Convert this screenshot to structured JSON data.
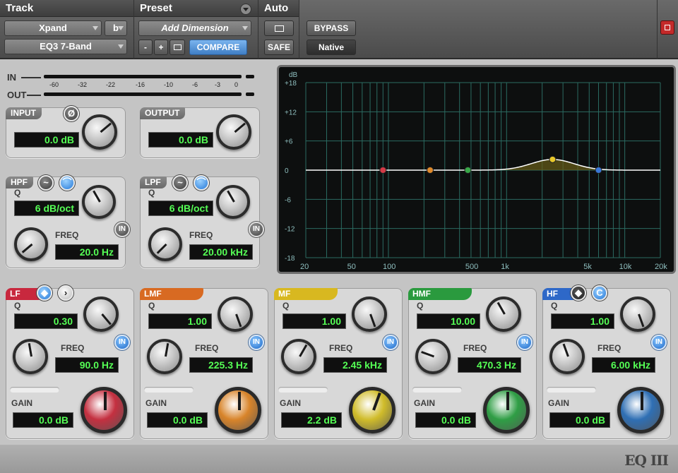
{
  "header": {
    "track_label": "Track",
    "preset_label": "Preset",
    "auto_label": "Auto",
    "track_name": "Xpand",
    "track_chan": "b",
    "plugin_name": "EQ3 7-Band",
    "preset_name": "Add Dimension",
    "minus": "-",
    "plus": "+",
    "compare": "COMPARE",
    "safe": "SAFE",
    "bypass": "BYPASS",
    "native": "Native"
  },
  "meters": {
    "in_label": "IN",
    "out_label": "OUT",
    "scale": [
      "-60",
      "-32",
      "-22",
      "-16",
      "-10",
      "-6",
      "-3",
      "0"
    ]
  },
  "input": {
    "label": "INPUT",
    "value": "0.0 dB",
    "phase_icon": "Ø"
  },
  "output": {
    "label": "OUTPUT",
    "value": "0.0 dB"
  },
  "hpf": {
    "label": "HPF",
    "q_label": "Q",
    "q_value": "6 dB/oct",
    "freq_label": "FREQ",
    "freq_value": "20.0 Hz",
    "in": "IN"
  },
  "lpf": {
    "label": "LPF",
    "q_label": "Q",
    "q_value": "6 dB/oct",
    "freq_label": "FREQ",
    "freq_value": "20.00 kHz",
    "in": "IN"
  },
  "graph": {
    "db_label": "dB",
    "y_ticks": [
      "+18",
      "+12",
      "+6",
      "0",
      "-6",
      "-12",
      "-18"
    ],
    "x_ticks": [
      "20",
      "50",
      "100",
      "500",
      "1k",
      "5k",
      "10k",
      "20k"
    ]
  },
  "bands": [
    {
      "label": "LF",
      "color": "#c8283e",
      "q": "0.30",
      "freq": "90.0 Hz",
      "gain": "0.0 dB"
    },
    {
      "label": "LMF",
      "color": "#d86a22",
      "q": "1.00",
      "freq": "225.3 Hz",
      "gain": "0.0 dB"
    },
    {
      "label": "MF",
      "color": "#d8b820",
      "q": "1.00",
      "freq": "2.45 kHz",
      "gain": "2.2 dB"
    },
    {
      "label": "HMF",
      "color": "#2a9a3e",
      "q": "10.00",
      "freq": "470.3 Hz",
      "gain": "0.0 dB"
    },
    {
      "label": "HF",
      "color": "#2e68c8",
      "q": "1.00",
      "freq": "6.00 kHz",
      "gain": "0.0 dB"
    }
  ],
  "band_common": {
    "q_label": "Q",
    "freq_label": "FREQ",
    "gain_label": "GAIN",
    "in": "IN"
  },
  "footer": {
    "logo": "EQ III"
  }
}
